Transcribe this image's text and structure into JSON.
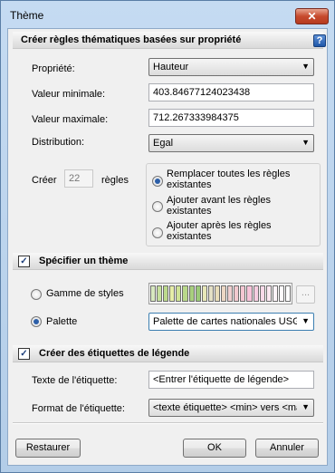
{
  "window": {
    "title": "Thème",
    "close_label": "✕"
  },
  "section_rules": {
    "title": "Créer règles thématiques basées sur propriété",
    "help_icon_label": "?",
    "property_label": "Propriété:",
    "property_value": "Hauteur",
    "min_label": "Valeur minimale:",
    "min_value": "403.84677124023438",
    "max_label": "Valeur maximale:",
    "max_value": "712.267333984375",
    "distribution_label": "Distribution:",
    "distribution_value": "Egal",
    "create_label": "Créer",
    "create_count": "22",
    "rules_label": "règles",
    "options": [
      {
        "label": "Remplacer toutes les règles existantes",
        "checked": true
      },
      {
        "label": "Ajouter avant les règles existantes",
        "checked": false
      },
      {
        "label": "Ajouter après les règles existantes",
        "checked": false
      }
    ]
  },
  "section_theme": {
    "title": "Spécifier un thème",
    "checked": true,
    "style_range_label": "Gamme de styles",
    "palette_label": "Palette",
    "palette_value": "Palette de cartes nationales USGS",
    "ellipsis_label": "...",
    "swatches": [
      "#d8e8c0",
      "#c6df9e",
      "#bcd98c",
      "#e6eda8",
      "#cfe296",
      "#b9d88a",
      "#a8cf7e",
      "#9bc978",
      "#e7e7b8",
      "#e4e0c6",
      "#e7dcb9",
      "#ecd7c4",
      "#efcfcf",
      "#f2c9cf",
      "#f4c6d2",
      "#f7c3d9",
      "#f6cde0",
      "#f8d9e8",
      "#fce8f1",
      "#fdf4f8",
      "#fefafc",
      "#ffffff"
    ]
  },
  "section_legend": {
    "title": "Créer des étiquettes de légende",
    "checked": true,
    "label_text_label": "Texte de l'étiquette:",
    "label_text_value": "<Entrer l'étiquette de légende>",
    "label_format_label": "Format de l'étiquette:",
    "label_format_value": "<texte étiquette> <min> vers <max>"
  },
  "buttons": {
    "restore": "Restaurer",
    "ok": "OK",
    "cancel": "Annuler"
  }
}
